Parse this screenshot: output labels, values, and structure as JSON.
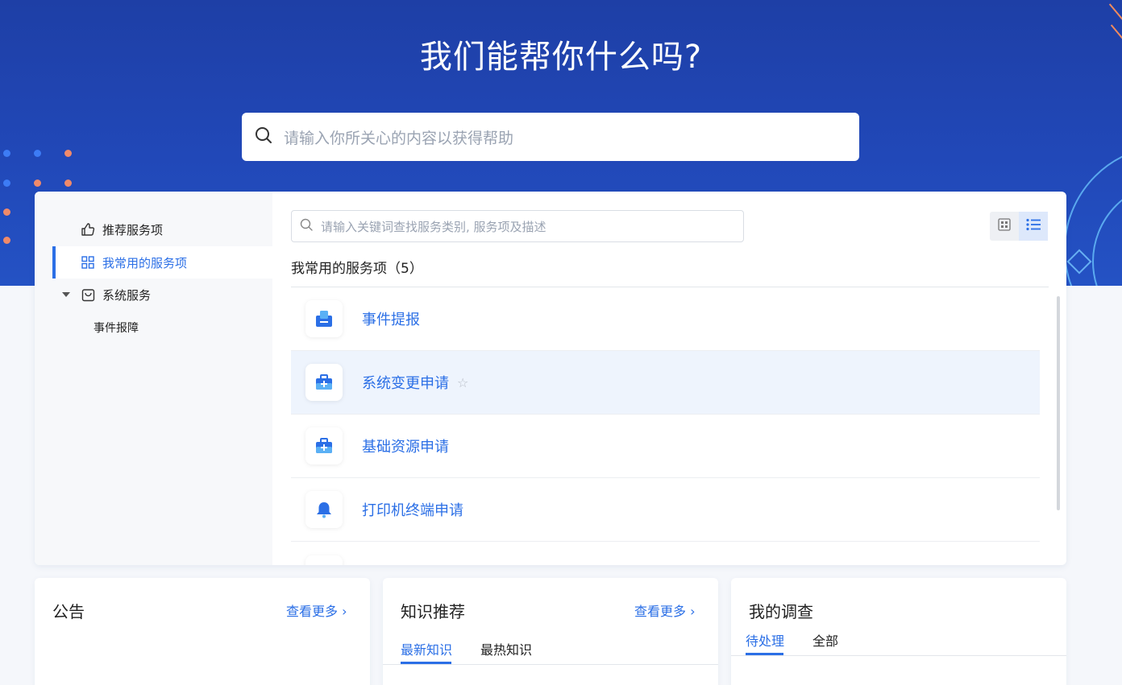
{
  "hero": {
    "title": "我们能帮你什么吗?",
    "search_placeholder": "请输入你所关心的内容以获得帮助"
  },
  "sidebar": {
    "items": [
      {
        "label": "推荐服务项",
        "icon": "thumbs-up-icon"
      },
      {
        "label": "我常用的服务项",
        "icon": "grid-icon",
        "active": true
      },
      {
        "label": "系统服务",
        "icon": "bag-icon",
        "expanded": true
      },
      {
        "label": "事件报障"
      }
    ]
  },
  "content": {
    "search_placeholder": "请输入关键词查找服务类别, 服务项及描述",
    "section_title": "我常用的服务项（5）",
    "services": [
      {
        "label": "事件提报",
        "icon": "inbox-icon"
      },
      {
        "label": "系统变更申请",
        "icon": "toolbox-icon",
        "starred": false
      },
      {
        "label": "基础资源申请",
        "icon": "toolbox-icon"
      },
      {
        "label": "打印机终端申请",
        "icon": "bell-icon"
      }
    ]
  },
  "announcements": {
    "title": "公告",
    "more": "查看更多"
  },
  "knowledge": {
    "title": "知识推荐",
    "more": "查看更多",
    "tabs": [
      "最新知识",
      "最热知识"
    ]
  },
  "survey": {
    "title": "我的调查",
    "tabs": [
      "待处理",
      "全部"
    ]
  },
  "colors": {
    "hero": "#1e3fa6",
    "accent": "#2b6fe6"
  }
}
